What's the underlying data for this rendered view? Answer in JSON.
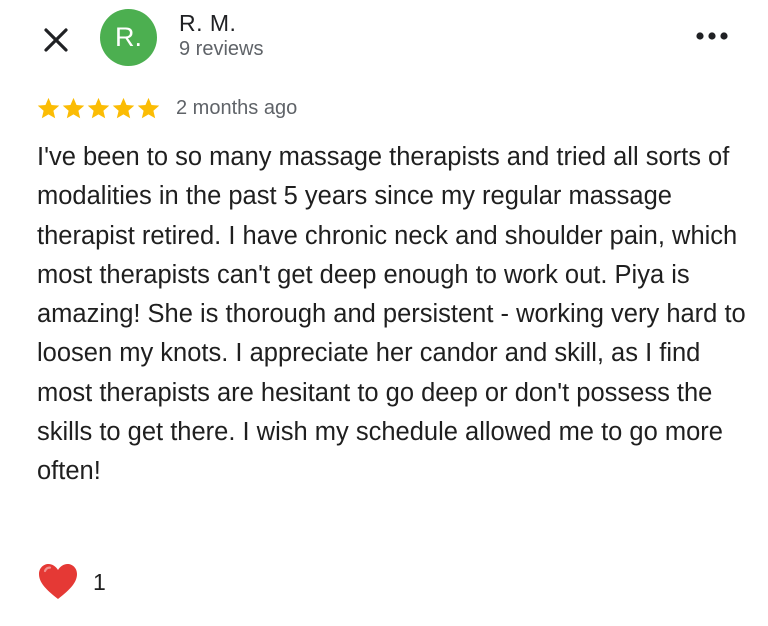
{
  "header": {
    "close_icon": "close-icon",
    "avatar": {
      "initial": "R.",
      "color": "#4caf50"
    },
    "reviewer_name": "R. M.",
    "review_count": "9 reviews",
    "more_icon": "more-horizontal-icon"
  },
  "review": {
    "rating": 5,
    "rating_max": 5,
    "star_color": "#fbbc04",
    "date": "2 months ago",
    "text": "I've been to so many massage therapists and tried all sorts of modalities in the past 5 years since my regular massage therapist retired. I have chronic neck and shoulder pain, which most therapists can't get deep enough to work out. Piya is amazing! She is thorough and persistent - working very hard to loosen my knots. I appreciate her candor and skill, as I find most therapists are hesitant to go deep or don't possess the skills to get there. I wish my schedule allowed me to go more often!"
  },
  "reactions": {
    "icon": "heart-icon",
    "color": "#e53935",
    "count": "1"
  }
}
